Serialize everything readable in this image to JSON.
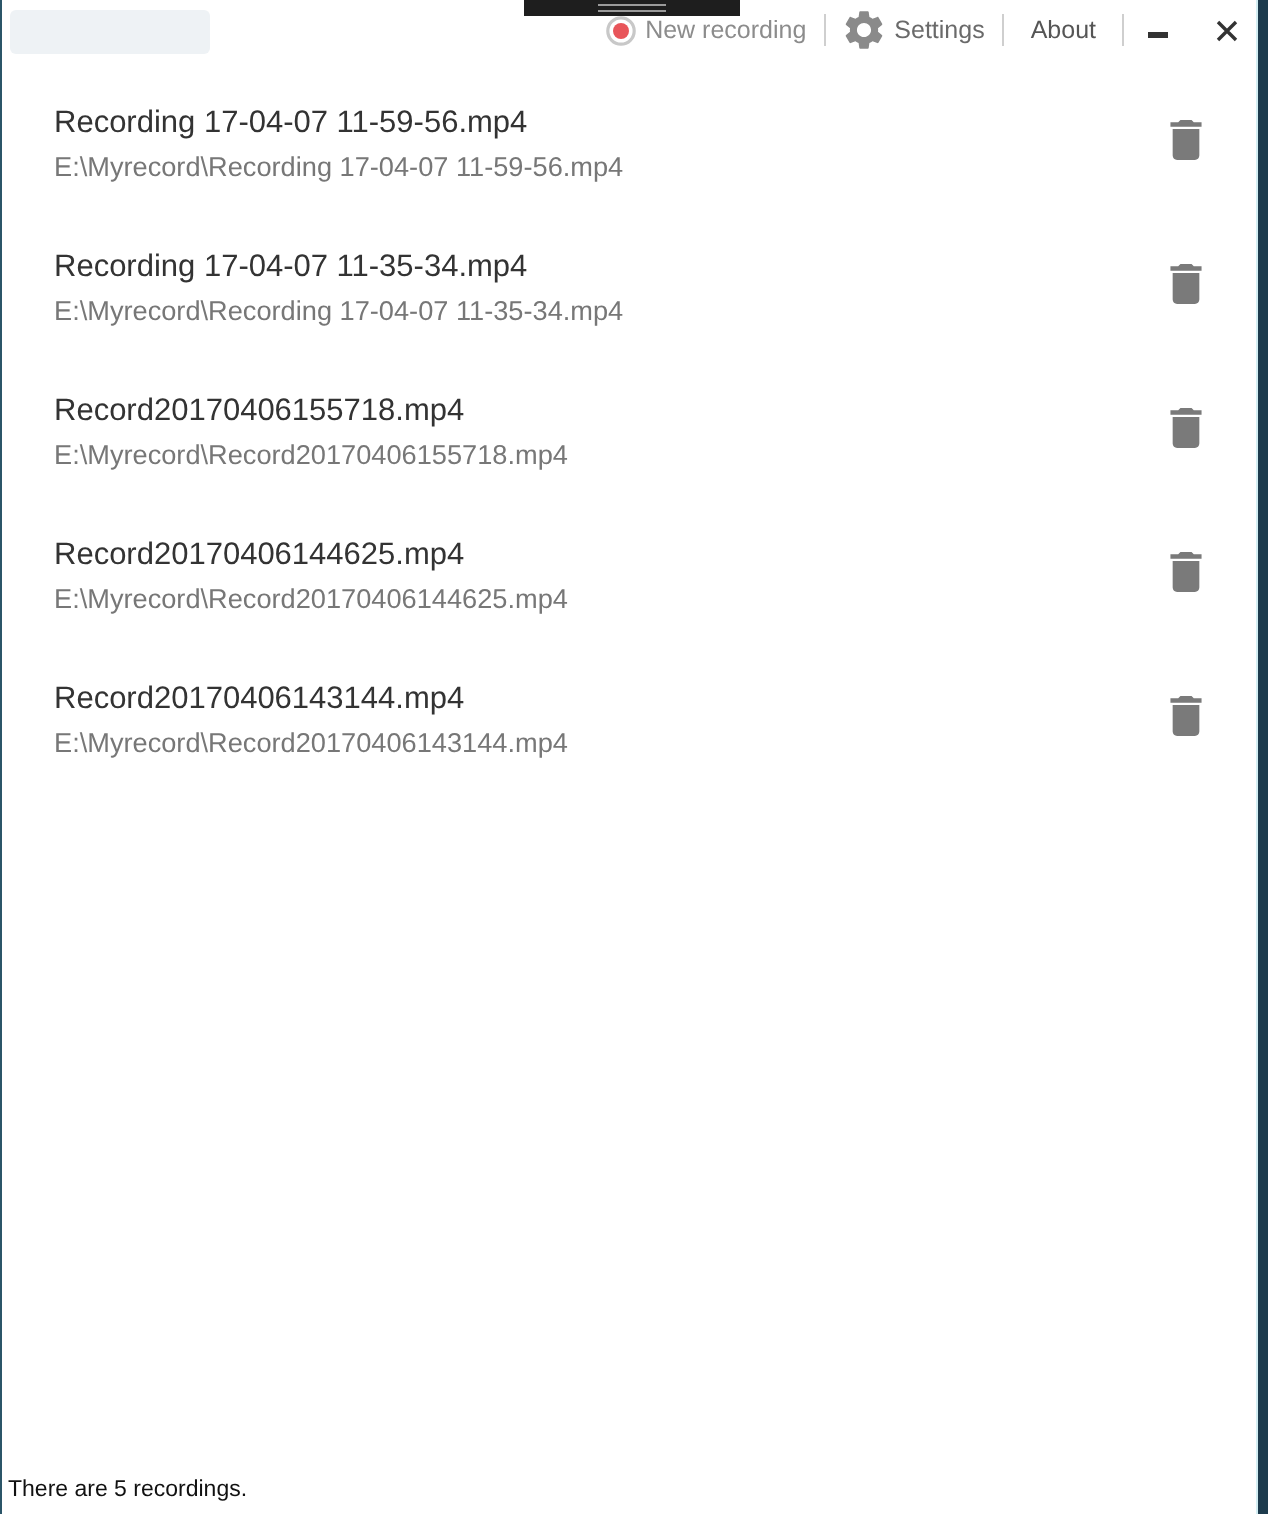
{
  "title_bar": {
    "actions": [
      {
        "kind": "record",
        "label": "New recording"
      },
      {
        "kind": "settings",
        "label": "Settings"
      },
      {
        "kind": "about",
        "label": "About"
      }
    ],
    "window_controls": [
      {
        "kind": "minimize"
      },
      {
        "kind": "close"
      }
    ]
  },
  "recordings": [
    {
      "name": "Recording 17-04-07 11-59-56.mp4",
      "path": "E:\\Myrecord\\Recording 17-04-07 11-59-56.mp4"
    },
    {
      "name": "Recording 17-04-07 11-35-34.mp4",
      "path": "E:\\Myrecord\\Recording 17-04-07 11-35-34.mp4"
    },
    {
      "name": "Record20170406155718.mp4",
      "path": "E:\\Myrecord\\Record20170406155718.mp4"
    },
    {
      "name": "Record20170406144625.mp4",
      "path": "E:\\Myrecord\\Record20170406144625.mp4"
    },
    {
      "name": "Record20170406143144.mp4",
      "path": "E:\\Myrecord\\Record20170406143144.mp4"
    }
  ],
  "status_bar": {
    "text": "There are 5 recordings."
  }
}
